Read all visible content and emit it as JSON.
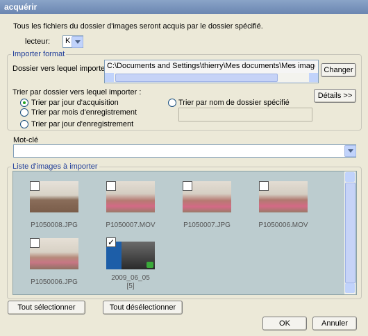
{
  "window": {
    "title": "acquérir"
  },
  "intro": "Tous les fichiers du dossier d'images seront acquis par le dossier spécifié.",
  "reader": {
    "label": "lecteur:",
    "value": "K"
  },
  "import_format": {
    "legend": "Importer format",
    "dest_label": "Dossier vers lequel importer :",
    "dest_path": "C:\\Documents and Settings\\thierry\\Mes documents\\Mes images\\PHOTOI",
    "change_button": "Changer",
    "sort_label": "Trier par dossier vers lequel importer :",
    "details_button": "Détails >>",
    "options": [
      {
        "label": "Trier par jour d'acquisition",
        "selected": true
      },
      {
        "label": "Trier par mois d'enregistrement",
        "selected": false
      },
      {
        "label": "Trier par jour d'enregistrement",
        "selected": false
      },
      {
        "label": "Trier par nom de dossier spécifié",
        "selected": false
      }
    ]
  },
  "keyword": {
    "label": "Mot-clé",
    "value": ""
  },
  "image_list": {
    "legend": "Liste d'images à importer",
    "items": [
      {
        "name": "P1050008.JPG",
        "checked": false
      },
      {
        "name": "P1050007.MOV",
        "checked": false
      },
      {
        "name": "P1050007.JPG",
        "checked": false
      },
      {
        "name": "P1050006.MOV",
        "checked": false
      },
      {
        "name": "P1050006.JPG",
        "checked": false
      },
      {
        "name": "2009_06_05",
        "count": "[5]",
        "checked": true
      }
    ]
  },
  "footer": {
    "select_all": "Tout sélectionner",
    "deselect_all": "Tout désélectionner",
    "ok": "OK",
    "cancel": "Annuler"
  },
  "colors": {
    "title_bar": "#7b93bd",
    "list_bg": "#bccccf",
    "legend_text": "#1f3d99"
  }
}
